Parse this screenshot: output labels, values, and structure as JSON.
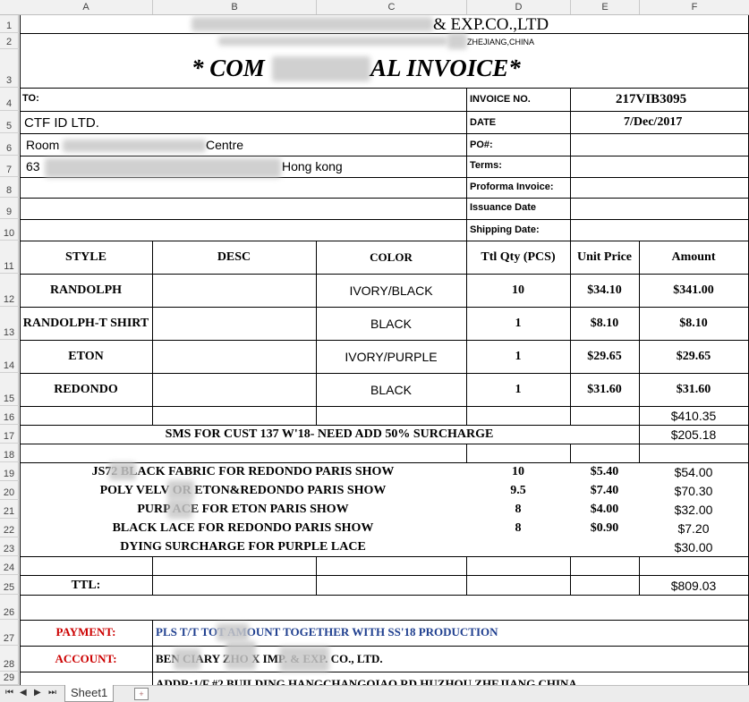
{
  "columns": [
    "A",
    "B",
    "C",
    "D",
    "E",
    "F"
  ],
  "rows": [
    "1",
    "2",
    "3",
    "4",
    "5",
    "6",
    "7",
    "8",
    "9",
    "10",
    "11",
    "12",
    "13",
    "14",
    "15",
    "16",
    "17",
    "18",
    "19",
    "20",
    "21",
    "22",
    "23",
    "24",
    "25",
    "26",
    "27",
    "28",
    "29"
  ],
  "company_name": "& EXP.CO.,LTD",
  "company_address": "ZHEJIANG,CHINA",
  "invoice_title_left": "* COM",
  "invoice_title_right": "AL  INVOICE*",
  "to_label": "TO:",
  "buyer_name": "CTF ID LTD.",
  "buyer_room": "Room",
  "buyer_room_tail": "Centre",
  "buyer_street": "63",
  "buyer_city": "Hong kong",
  "invoice_no_label": "INVOICE NO.",
  "invoice_no": "217VIB3095",
  "date_label": "DATE",
  "date": "7/Dec/2017",
  "po_label": "PO#:",
  "terms_label": "Terms:",
  "proforma_label": "Proforma Invoice:",
  "issuance_label": "Issuance Date",
  "shipping_label": "Shipping Date:",
  "headers": [
    "STYLE",
    "DESC",
    "COLOR",
    "Ttl Qty (PCS)",
    "Unit Price",
    "Amount"
  ],
  "items": [
    {
      "style": "RANDOLPH",
      "color": "IVORY/BLACK",
      "qty": "10",
      "price": "$34.10",
      "amount": "$341.00"
    },
    {
      "style": "RANDOLPH-T SHIRT",
      "color": "BLACK",
      "qty": "1",
      "price": "$8.10",
      "amount": "$8.10"
    },
    {
      "style": "ETON",
      "color": "IVORY/PURPLE",
      "qty": "1",
      "price": "$29.65",
      "amount": "$29.65"
    },
    {
      "style": "REDONDO",
      "color": "BLACK",
      "qty": "1",
      "price": "$31.60",
      "amount": "$31.60"
    }
  ],
  "subtotal": "$410.35",
  "surcharge_text": "SMS FOR CUST 137 W'18- NEED ADD 50% SURCHARGE",
  "surcharge_amount": "$205.18",
  "extras": [
    {
      "desc": "JS72      BLACK FABRIC FOR REDONDO PARIS SHOW",
      "qty": "10",
      "price": "$5.40",
      "amount": "$54.00"
    },
    {
      "desc": "POLY VELV      OR ETON&REDONDO PARIS SHOW",
      "qty": "9.5",
      "price": "$7.40",
      "amount": "$70.30"
    },
    {
      "desc": "PURP      ACE FOR ETON PARIS SHOW",
      "qty": "8",
      "price": "$4.00",
      "amount": "$32.00"
    },
    {
      "desc": "BLACK LACE FOR REDONDO PARIS SHOW",
      "qty": "8",
      "price": "$0.90",
      "amount": "$7.20"
    },
    {
      "desc": "DYING SURCHARGE FOR PURPLE LACE",
      "qty": "",
      "price": "",
      "amount": "$30.00"
    }
  ],
  "ttl_label": "TTL:",
  "ttl_amount": "$809.03",
  "payment_label": "PAYMENT:",
  "payment_text": "PLS T/T TOT      AMOUNT TOGETHER WITH SS'18 PRODUCTION",
  "account_label": "ACCOUNT:",
  "account_text": "BEN      CIARY      ZHO      X IMP. & EXP.  CO., LTD.",
  "address_partial": "ADDR:1/F #2 BUILDING HANGCHANGQIAO RD HUZHOU ZHEJIANG CHINA",
  "sheet_tab": "Sheet1",
  "colors": {
    "payment_label": "#cc0000",
    "payment_text": "#1f3f8f"
  }
}
